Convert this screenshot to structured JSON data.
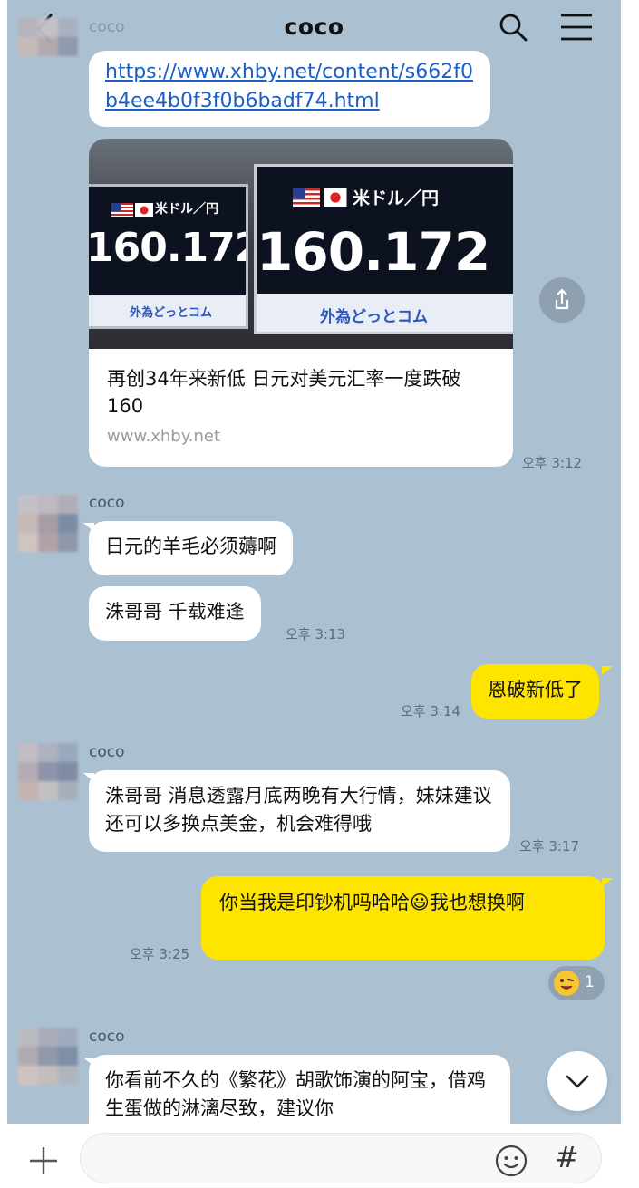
{
  "header": {
    "title": "coco",
    "back_icon": "chevron-left-icon",
    "search_icon": "search-icon",
    "menu_icon": "hamburger-menu-icon"
  },
  "messages": {
    "partial_sender": "coco",
    "link_url": "https://www.xhby.net/content/s662f0b4ee4b0f3f0b6badf74.html",
    "card": {
      "image_pair_text": "米ドル／円",
      "image_rate": "160.172",
      "image_brand": "外為どっとコム",
      "title": "再创34年来新低 日元对美元汇率一度跌破160",
      "domain": "www.xhby.net",
      "time": "오후 3:12"
    },
    "group1": {
      "sender": "coco",
      "msg1": "日元的羊毛必须薅啊",
      "msg2": "洙哥哥 千载难逢",
      "time": "오후 3:13"
    },
    "mine1": {
      "text": "恩破新低了",
      "time": "오후 3:14"
    },
    "group2": {
      "sender": "coco",
      "text": "洙哥哥  消息透露月底两晚有大行情，妹妹建议还可以多换点美金，机会难得哦",
      "time": "오후 3:17"
    },
    "mine2": {
      "text_before": "你当我是印钞机吗哈哈",
      "emoji": "😃",
      "text_after": "我也想换啊",
      "time": "오후 3:25",
      "reaction_emoji": "😜",
      "reaction_count": "1"
    },
    "group3": {
      "sender": "coco",
      "text": "你看前不久的《繁花》胡歌饰演的阿宝，借鸡生蛋做的淋漓尽致，建议你"
    }
  },
  "colors": {
    "chat_bg": "#abc1d1",
    "my_bubble": "#fee500",
    "their_bubble": "#ffffff",
    "link": "#1a5fc7"
  },
  "input": {
    "placeholder": "",
    "plus_icon": "plus-icon",
    "emoji_icon": "smiley-icon",
    "hash_label": "#"
  },
  "scroll_down_icon": "chevron-down-icon",
  "share_icon": "share-icon"
}
